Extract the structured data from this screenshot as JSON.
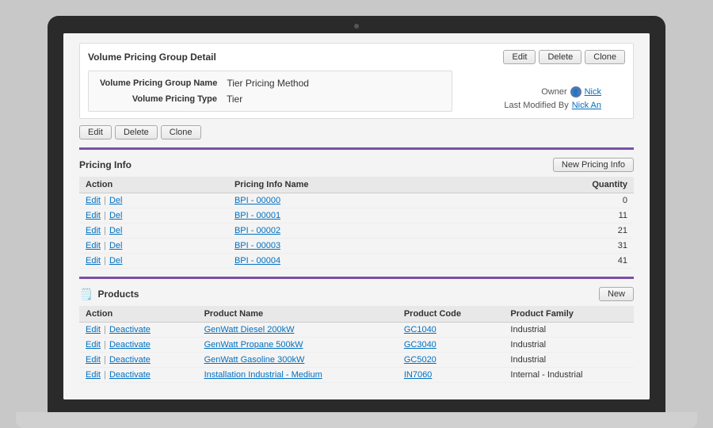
{
  "laptop": {
    "camera_label": "camera"
  },
  "detail": {
    "title": "Volume Pricing Group Detail",
    "buttons": {
      "edit": "Edit",
      "delete": "Delete",
      "clone": "Clone"
    },
    "fields": {
      "group_name_label": "Volume Pricing Group Name",
      "group_name_value": "Tier Pricing Method",
      "type_label": "Volume Pricing Type",
      "type_value": "Tier"
    },
    "owner_label": "Owner",
    "owner_value": "Nick",
    "last_modified_label": "Last Modified By",
    "last_modified_value": "Nick An"
  },
  "pricing_info": {
    "section_title": "Pricing Info",
    "new_button": "New Pricing Info",
    "columns": {
      "action": "Action",
      "name": "Pricing Info Name",
      "quantity": "Quantity"
    },
    "rows": [
      {
        "action_edit": "Edit",
        "action_del": "Del",
        "name": "BPI - 00000",
        "quantity": "0"
      },
      {
        "action_edit": "Edit",
        "action_del": "Del",
        "name": "BPI - 00001",
        "quantity": "11"
      },
      {
        "action_edit": "Edit",
        "action_del": "Del",
        "name": "BPI - 00002",
        "quantity": "21"
      },
      {
        "action_edit": "Edit",
        "action_del": "Del",
        "name": "BPI - 00003",
        "quantity": "31"
      },
      {
        "action_edit": "Edit",
        "action_del": "Del",
        "name": "BPI - 00004",
        "quantity": "41"
      }
    ]
  },
  "products": {
    "section_title": "Products",
    "new_button": "New",
    "columns": {
      "action": "Action",
      "product_name": "Product Name",
      "product_code": "Product Code",
      "product_family": "Product Family"
    },
    "rows": [
      {
        "action_edit": "Edit",
        "action_deactivate": "Deactivate",
        "name": "GenWatt Diesel 200kW",
        "code": "GC1040",
        "family": "Industrial"
      },
      {
        "action_edit": "Edit",
        "action_deactivate": "Deactivate",
        "name": "GenWatt Propane 500kW",
        "code": "GC3040",
        "family": "Industrial"
      },
      {
        "action_edit": "Edit",
        "action_deactivate": "Deactivate",
        "name": "GenWatt Gasoline 300kW",
        "code": "GC5020",
        "family": "Industrial"
      },
      {
        "action_edit": "Edit",
        "action_deactivate": "Deactivate",
        "name": "Installation  Industrial - Medium",
        "code": "IN7060",
        "family": "Internal - Industrial"
      }
    ]
  }
}
